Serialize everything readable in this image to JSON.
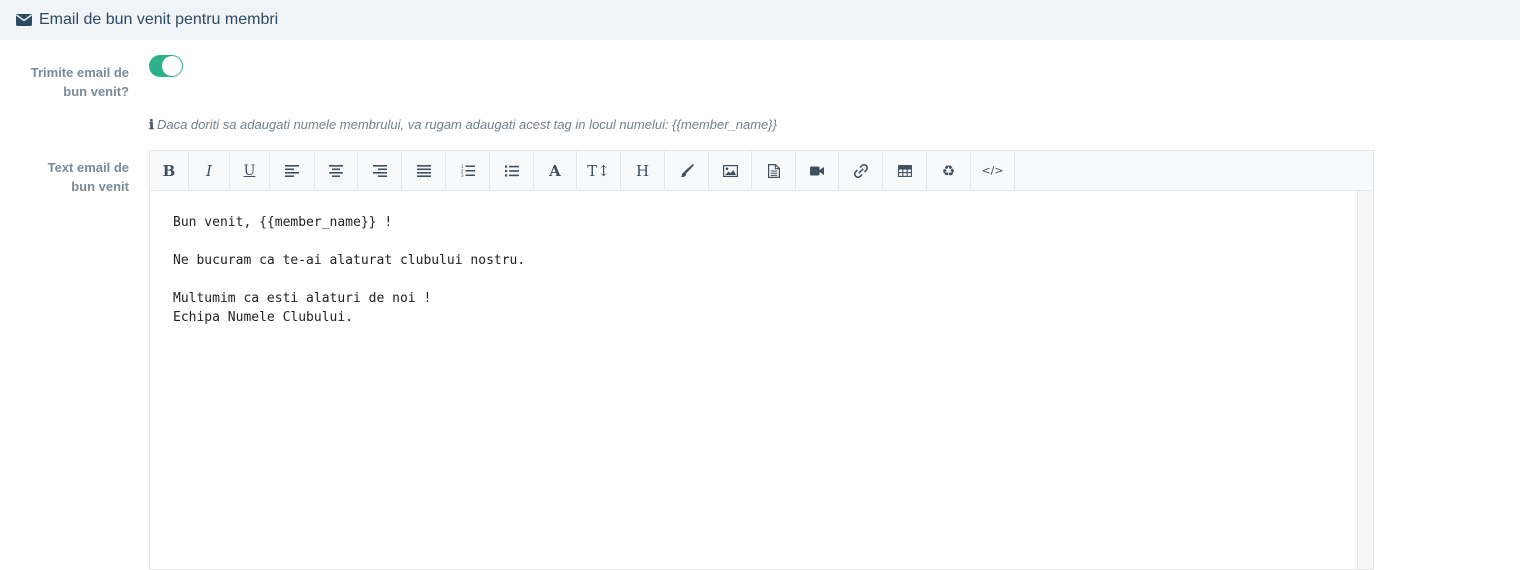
{
  "header": {
    "icon": "envelope-icon",
    "title": "Email de bun venit pentru membri"
  },
  "send_welcome": {
    "label_line1": "Trimite email de",
    "label_line2": "bun venit?",
    "enabled": true,
    "toggle_color": "#2bb28d"
  },
  "hint": {
    "icon": "info-icon",
    "text": "Daca doriti sa adaugati numele membrului, va rugam adaugati acest tag in locul numelui: {{member_name}}"
  },
  "email_text": {
    "label_line1": "Text email de",
    "label_line2": "bun venit",
    "toolbar": [
      {
        "icon": "bold-icon",
        "glyph": "B"
      },
      {
        "icon": "italic-icon",
        "glyph": "I"
      },
      {
        "icon": "underline-icon",
        "glyph": "U"
      },
      {
        "icon": "align-left-icon",
        "glyph": ""
      },
      {
        "icon": "align-center-icon",
        "glyph": ""
      },
      {
        "icon": "align-right-icon",
        "glyph": ""
      },
      {
        "icon": "align-justify-icon",
        "glyph": ""
      },
      {
        "icon": "ordered-list-icon",
        "glyph": ""
      },
      {
        "icon": "unordered-list-icon",
        "glyph": ""
      },
      {
        "icon": "font-color-icon",
        "glyph": "A"
      },
      {
        "icon": "font-size-icon",
        "glyph": "T↕"
      },
      {
        "icon": "heading-icon",
        "glyph": "H"
      },
      {
        "icon": "paint-brush-icon",
        "glyph": ""
      },
      {
        "icon": "image-icon",
        "glyph": ""
      },
      {
        "icon": "file-icon",
        "glyph": ""
      },
      {
        "icon": "video-icon",
        "glyph": ""
      },
      {
        "icon": "link-icon",
        "glyph": ""
      },
      {
        "icon": "table-icon",
        "glyph": ""
      },
      {
        "icon": "recycle-icon",
        "glyph": "♻"
      },
      {
        "icon": "code-view-icon",
        "glyph": "</>"
      }
    ],
    "content_lines": [
      "Bun venit, {{member_name}} !",
      "",
      "Ne bucuram ca te-ai alaturat clubului nostru.",
      "",
      "Multumim ca esti alaturi de noi !",
      "Echipa Numele Clubului."
    ]
  }
}
